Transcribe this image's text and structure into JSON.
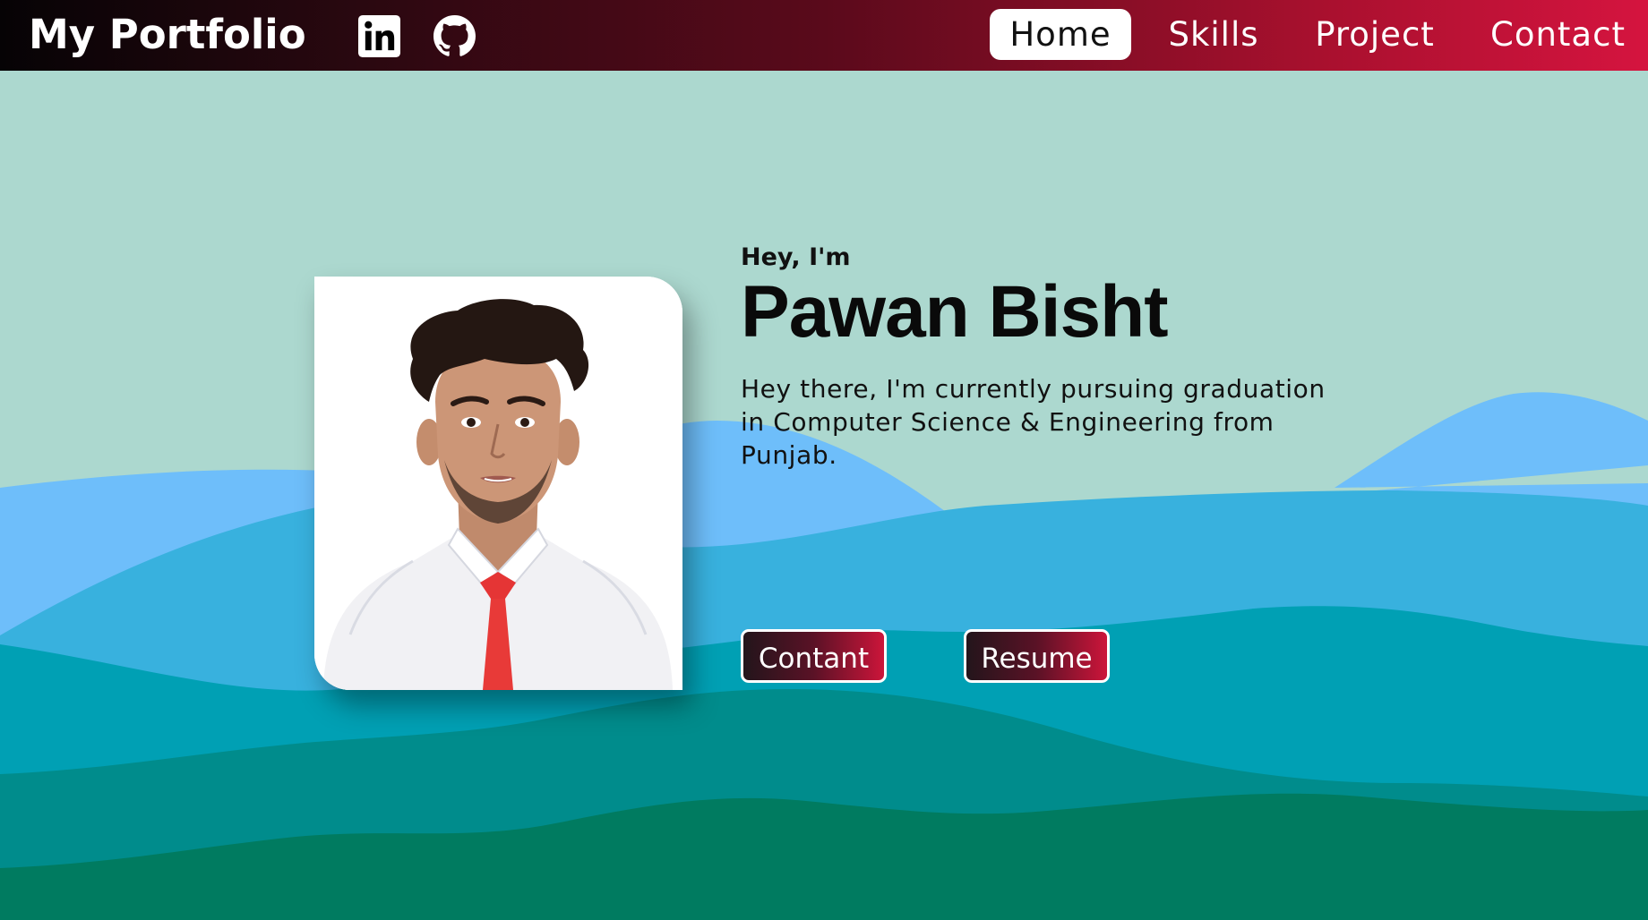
{
  "navbar": {
    "brand": "My Portfolio",
    "social": [
      {
        "icon": "linkedin-icon"
      },
      {
        "icon": "github-icon"
      }
    ],
    "links": [
      {
        "label": "Home",
        "active": true
      },
      {
        "label": "Skills",
        "active": false
      },
      {
        "label": "Project",
        "active": false
      },
      {
        "label": "Contact",
        "active": false
      }
    ]
  },
  "hero": {
    "greeting": "Hey, I'm",
    "name": "Pawan Bisht",
    "bio": "Hey there, I'm currently pursuing graduation in Computer Science & Engineering from Punjab.",
    "buttons": {
      "contact": "Contant",
      "resume": "Resume"
    }
  },
  "colors": {
    "background": "#acd8cf",
    "nav_gradient_start": "#060305",
    "nav_gradient_end": "#d5143f",
    "wave_light_blue": "#6ebefa",
    "wave_blue": "#38b1de",
    "wave_teal": "#00a0b4",
    "wave_dark_teal": "#008c8c",
    "wave_green": "#007b60"
  }
}
